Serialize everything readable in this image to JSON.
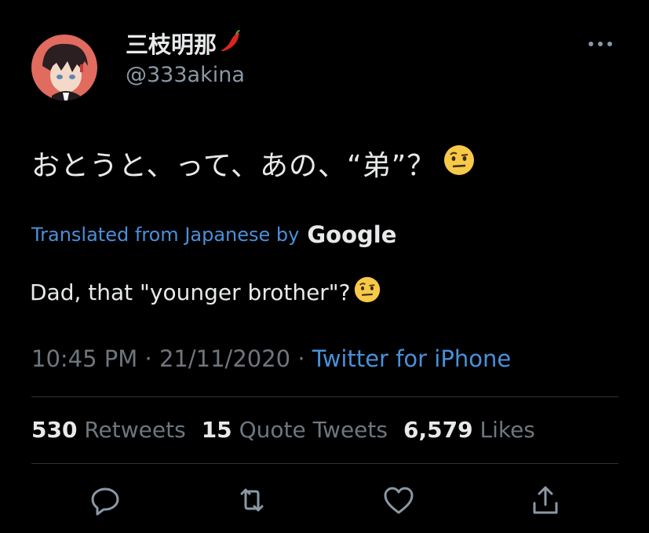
{
  "user": {
    "display_name": "三枝明那",
    "handle": "@333akina"
  },
  "tweet": {
    "text": "おとうと、って、あの、“弟”？"
  },
  "translation": {
    "label": "Translated from Japanese by",
    "provider": "Google",
    "text": "Dad, that \"younger brother\"?"
  },
  "meta": {
    "time": "10:45 PM",
    "sep1": " · ",
    "date": "21/11/2020",
    "sep2": " · ",
    "source": "Twitter for iPhone"
  },
  "stats": [
    {
      "count": "530",
      "label": "Retweets"
    },
    {
      "count": "15",
      "label": "Quote Tweets"
    },
    {
      "count": "6,579",
      "label": "Likes"
    }
  ],
  "icons": {
    "reply": "reply-icon",
    "retweet": "retweet-icon",
    "like": "heart-icon",
    "share": "share-icon",
    "more": "more-icon",
    "emoji": "raised-eyebrow-emoji",
    "badge": "chili-pepper-emoji"
  },
  "colors": {
    "background": "#000000",
    "link": "#4a90d9",
    "secondary": "#6e767d",
    "primary_text": "#e7e9ea"
  }
}
